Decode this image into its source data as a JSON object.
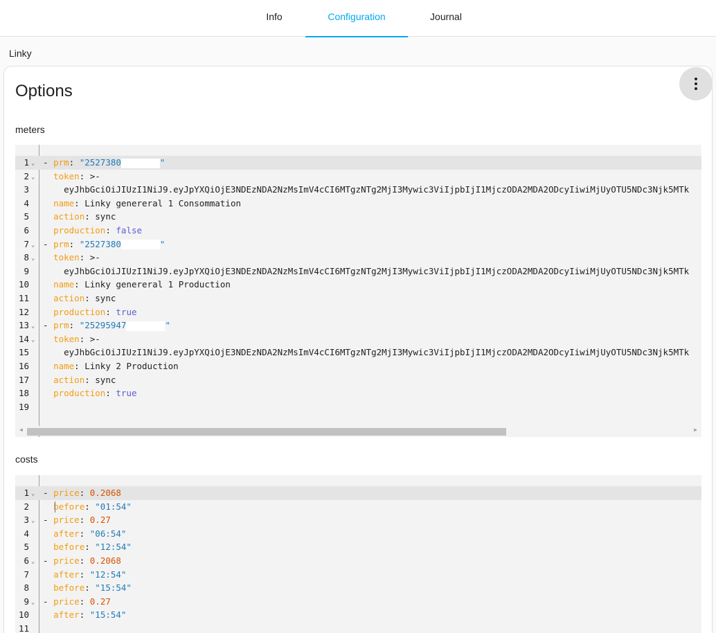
{
  "tabs": [
    {
      "label": "Info"
    },
    {
      "label": "Configuration"
    },
    {
      "label": "Journal"
    }
  ],
  "addon_name": "Linky",
  "card": {
    "title": "Options",
    "menu_icon": "dots-vertical-icon"
  },
  "fields": {
    "meters_label": "meters",
    "costs_label": "costs"
  },
  "colors": {
    "accent": "#03a9f4",
    "yaml_key": "#f39c12",
    "yaml_string": "#1f7ab8",
    "yaml_number": "#d35400",
    "yaml_bool": "#5c5cd6"
  },
  "meters_lines": [
    {
      "num": "1",
      "fold": true,
      "indent": "",
      "dash": "- ",
      "key": "prm",
      "sep": ": ",
      "val": "\"2527380",
      "vtype": "s",
      "redacted": true,
      "tail": "\""
    },
    {
      "num": "2",
      "fold": true,
      "indent": "  ",
      "key": "token",
      "sep": ": ",
      "val": ">-",
      "vtype": "p"
    },
    {
      "num": "3",
      "indent": "    ",
      "val": "eyJhbGciOiJIUzI1NiJ9.eyJpYXQiOjE3NDEzNDA2NzMsImV4cCI6MTgzNTg2MjI3Mywic3ViIjpbIjI1MjczODA2MDA2ODcyIiwiMjUyOTU5NDc3Njk5MTk",
      "vtype": "p"
    },
    {
      "num": "4",
      "indent": "  ",
      "key": "name",
      "sep": ": ",
      "val": "Linky genereral 1 Consommation",
      "vtype": "p"
    },
    {
      "num": "5",
      "indent": "  ",
      "key": "action",
      "sep": ": ",
      "val": "sync",
      "vtype": "p"
    },
    {
      "num": "6",
      "indent": "  ",
      "key": "production",
      "sep": ": ",
      "val": "false",
      "vtype": "b"
    },
    {
      "num": "7",
      "fold": true,
      "indent": "",
      "dash": "- ",
      "key": "prm",
      "sep": ": ",
      "val": "\"2527380",
      "vtype": "s",
      "redacted": true,
      "tail": "\""
    },
    {
      "num": "8",
      "fold": true,
      "indent": "  ",
      "key": "token",
      "sep": ": ",
      "val": ">-",
      "vtype": "p"
    },
    {
      "num": "9",
      "indent": "    ",
      "val": "eyJhbGciOiJIUzI1NiJ9.eyJpYXQiOjE3NDEzNDA2NzMsImV4cCI6MTgzNTg2MjI3Mywic3ViIjpbIjI1MjczODA2MDA2ODcyIiwiMjUyOTU5NDc3Njk5MTk",
      "vtype": "p"
    },
    {
      "num": "10",
      "indent": "  ",
      "key": "name",
      "sep": ": ",
      "val": "Linky genereral 1 Production",
      "vtype": "p"
    },
    {
      "num": "11",
      "indent": "  ",
      "key": "action",
      "sep": ": ",
      "val": "sync",
      "vtype": "p"
    },
    {
      "num": "12",
      "indent": "  ",
      "key": "production",
      "sep": ": ",
      "val": "true",
      "vtype": "b"
    },
    {
      "num": "13",
      "fold": true,
      "indent": "",
      "dash": "- ",
      "key": "prm",
      "sep": ": ",
      "val": "\"25295947",
      "vtype": "s",
      "redacted": true,
      "tail": "\""
    },
    {
      "num": "14",
      "fold": true,
      "indent": "  ",
      "key": "token",
      "sep": ": ",
      "val": ">-",
      "vtype": "p"
    },
    {
      "num": "15",
      "indent": "    ",
      "val": "eyJhbGciOiJIUzI1NiJ9.eyJpYXQiOjE3NDEzNDA2NzMsImV4cCI6MTgzNTg2MjI3Mywic3ViIjpbIjI1MjczODA2MDA2ODcyIiwiMjUyOTU5NDc3Njk5MTk",
      "vtype": "p"
    },
    {
      "num": "16",
      "indent": "  ",
      "key": "name",
      "sep": ": ",
      "val": "Linky 2 Production",
      "vtype": "p"
    },
    {
      "num": "17",
      "indent": "  ",
      "key": "action",
      "sep": ": ",
      "val": "sync",
      "vtype": "p"
    },
    {
      "num": "18",
      "indent": "  ",
      "key": "production",
      "sep": ": ",
      "val": "true",
      "vtype": "b"
    },
    {
      "num": "19",
      "indent": ""
    }
  ],
  "costs_lines": [
    {
      "num": "1",
      "fold": true,
      "indent": "",
      "dash": "- ",
      "key": "price",
      "sep": ": ",
      "val": "0.2068",
      "vtype": "n"
    },
    {
      "num": "2",
      "indent": "  ",
      "key": "before",
      "sep": ": ",
      "val": "\"01:54\"",
      "vtype": "s"
    },
    {
      "num": "3",
      "fold": true,
      "indent": "",
      "dash": "- ",
      "key": "price",
      "sep": ": ",
      "val": "0.27",
      "vtype": "n"
    },
    {
      "num": "4",
      "indent": "  ",
      "key": "after",
      "sep": ": ",
      "val": "\"06:54\"",
      "vtype": "s"
    },
    {
      "num": "5",
      "indent": "  ",
      "key": "before",
      "sep": ": ",
      "val": "\"12:54\"",
      "vtype": "s"
    },
    {
      "num": "6",
      "fold": true,
      "indent": "",
      "dash": "- ",
      "key": "price",
      "sep": ": ",
      "val": "0.2068",
      "vtype": "n"
    },
    {
      "num": "7",
      "indent": "  ",
      "key": "after",
      "sep": ": ",
      "val": "\"12:54\"",
      "vtype": "s"
    },
    {
      "num": "8",
      "indent": "  ",
      "key": "before",
      "sep": ": ",
      "val": "\"15:54\"",
      "vtype": "s"
    },
    {
      "num": "9",
      "fold": true,
      "indent": "",
      "dash": "- ",
      "key": "price",
      "sep": ": ",
      "val": "0.27",
      "vtype": "n"
    },
    {
      "num": "10",
      "indent": "  ",
      "key": "after",
      "sep": ": ",
      "val": "\"15:54\"",
      "vtype": "s"
    },
    {
      "num": "11",
      "indent": ""
    }
  ]
}
